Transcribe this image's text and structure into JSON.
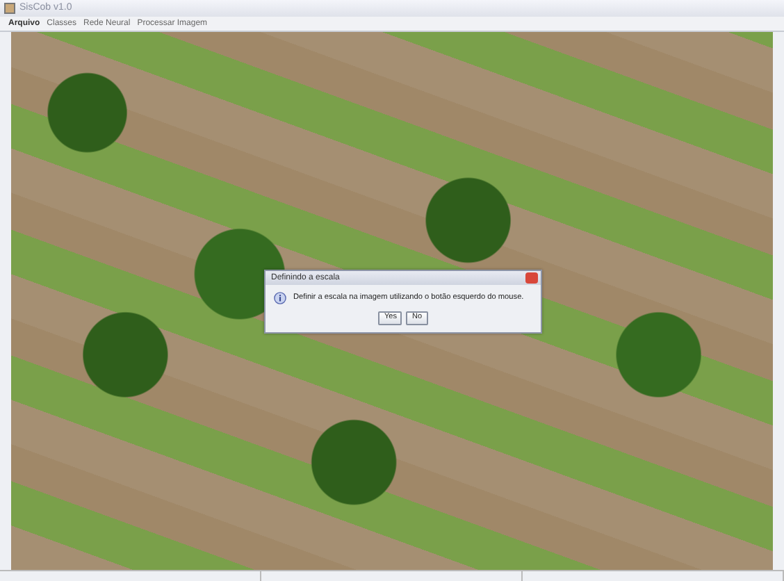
{
  "window": {
    "title": "SisCob v1.0"
  },
  "menu": [
    "Arquivo",
    "Classes",
    "Rede Neural",
    "Processar Imagem"
  ],
  "dialog": {
    "title": "Definindo a escala",
    "message": "Definir a escala na imagem utilizando o botão esquerdo do mouse.",
    "buttons": [
      "Yes",
      "No"
    ]
  }
}
